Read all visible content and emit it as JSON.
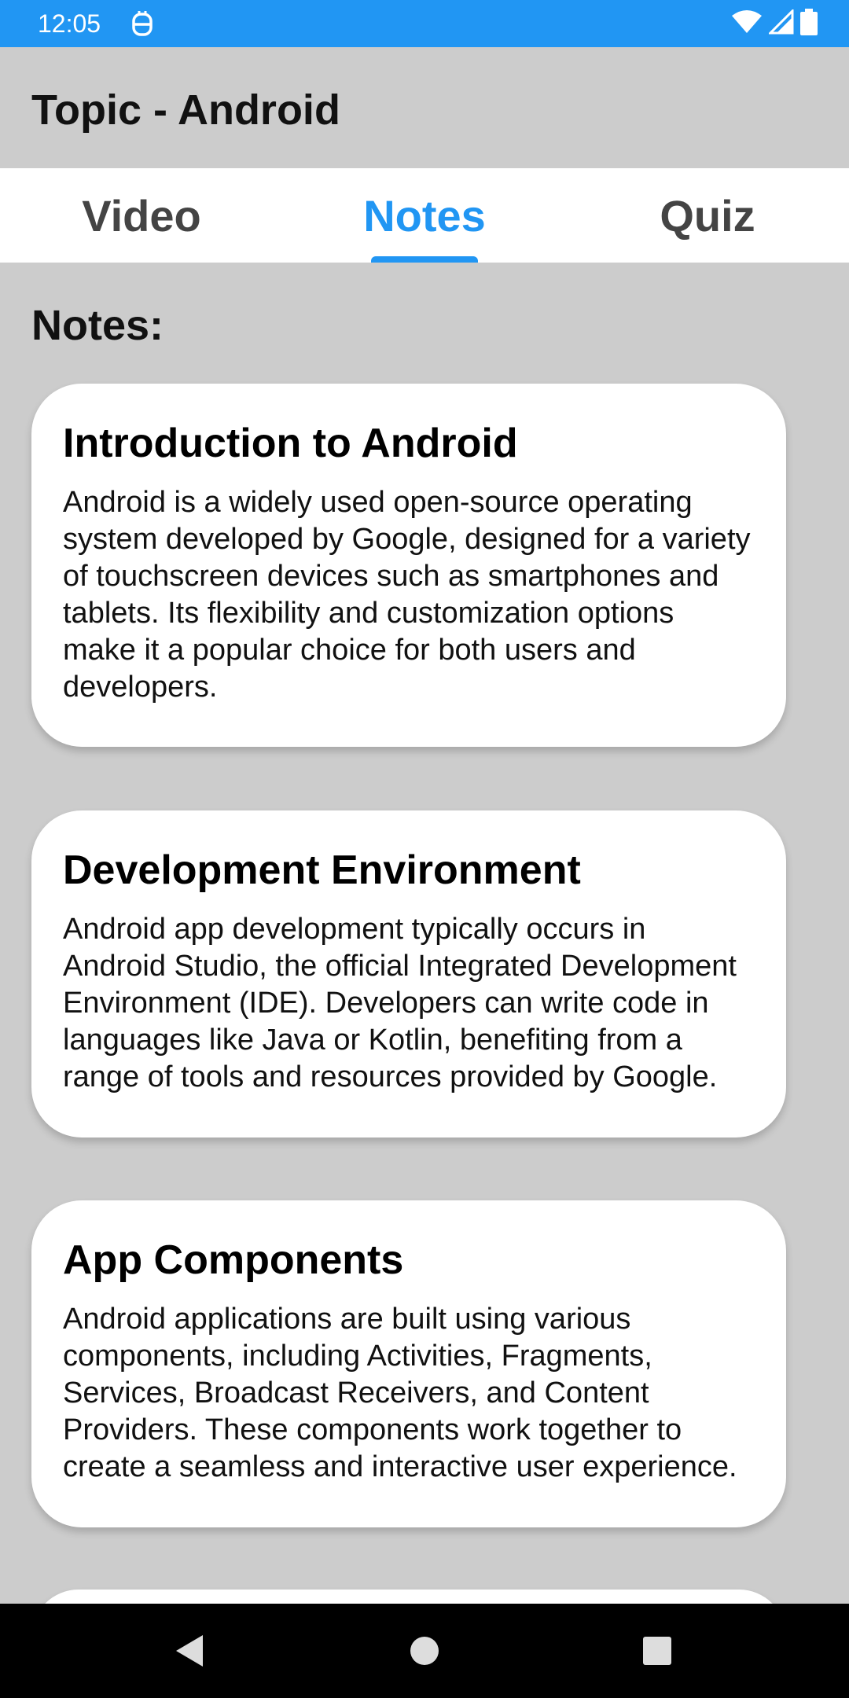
{
  "status_bar": {
    "time": "12:05",
    "icons": [
      "notification-icon",
      "wifi-icon",
      "signal-icon",
      "battery-icon"
    ],
    "background": "#2196f3"
  },
  "app_bar": {
    "title": "Topic - Android"
  },
  "tabs": [
    {
      "label": "Video",
      "active": false
    },
    {
      "label": "Notes",
      "active": true
    },
    {
      "label": "Quiz",
      "active": false
    }
  ],
  "accent_color": "#2196f3",
  "notes": {
    "heading": "Notes:",
    "cards": [
      {
        "title": "Introduction to Android",
        "body": "Android is a widely used open-source operating system developed by Google, designed for a variety of touchscreen devices such as smartphones and tablets. Its flexibility and customization options make it a popular choice for both users and developers."
      },
      {
        "title": "Development Environment",
        "body": "Android app development typically occurs in Android Studio, the official Integrated Development Environment (IDE). Developers can write code in languages like Java or Kotlin, benefiting from a range of tools and resources provided by Google."
      },
      {
        "title": "App Components",
        "body": "Android applications are built using various components, including Activities, Fragments, Services, Broadcast Receivers, and Content Providers. These components work together to create a seamless and interactive user experience."
      }
    ]
  },
  "nav_bar": {
    "icons": [
      "back-icon",
      "home-icon",
      "recents-icon"
    ]
  }
}
